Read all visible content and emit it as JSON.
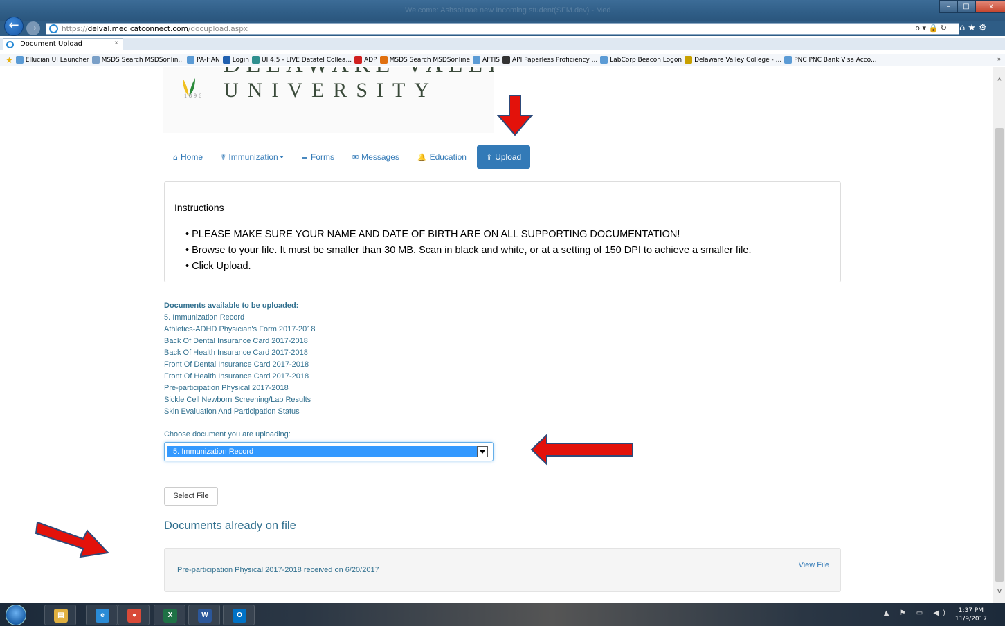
{
  "browser": {
    "window_title": "Welcome: Ashsolinae new Incoming student(SFM.dev) - Med",
    "url_scheme": "https://",
    "url_domain": "delval.medicatconnect.com",
    "url_path": "/docupload.aspx",
    "addr_tools": "ρ ▾ 🔒 ↻",
    "tab_title": "Document Upload",
    "tab_close": "×",
    "favorites": [
      {
        "label": "Ellucian UI Launcher",
        "color": "#5b9bd5"
      },
      {
        "label": "MSDS Search MSDSonlin...",
        "color": "#7aa0c8"
      },
      {
        "label": "PA-HAN",
        "color": "#5b9bd5"
      },
      {
        "label": "Login",
        "color": "#2060b0"
      },
      {
        "label": "UI 4.5 - LIVE Datatel Collea...",
        "color": "#2f8f8f"
      },
      {
        "label": "ADP",
        "color": "#d02020"
      },
      {
        "label": "MSDS Search MSDSonline",
        "color": "#e07010"
      },
      {
        "label": "AFTIS",
        "color": "#5b9bd5"
      },
      {
        "label": "API Paperless Proficiency ...",
        "color": "#333333"
      },
      {
        "label": "LabCorp Beacon Logon",
        "color": "#5b9bd5"
      },
      {
        "label": "Delaware Valley College - ...",
        "color": "#c8a000"
      },
      {
        "label": "PNC PNC Bank Visa Acco...",
        "color": "#5b9bd5"
      }
    ],
    "favorites_more": "»",
    "window_buttons": {
      "minimize": "–",
      "maximize": "□",
      "close": "x"
    }
  },
  "logo": {
    "name_top": "DELAWARE VALLEY",
    "name": "UNIVERSITY",
    "year": "1896"
  },
  "nav": {
    "items": [
      {
        "label": "Home",
        "icon": "home-icon",
        "glyph": "⌂"
      },
      {
        "label": "Immunization",
        "icon": "stethoscope-icon",
        "glyph": "☤"
      },
      {
        "label": "Forms",
        "icon": "list-icon",
        "glyph": "≡"
      },
      {
        "label": "Messages",
        "icon": "envelope-icon",
        "glyph": "✉"
      },
      {
        "label": "Education",
        "icon": "bell-icon",
        "glyph": "🔔"
      },
      {
        "label": "Upload",
        "icon": "upload-icon",
        "glyph": "⇪",
        "active": true
      }
    ]
  },
  "instructions": {
    "title": "Instructions",
    "items": [
      "PLEASE MAKE SURE YOUR NAME AND DATE OF BIRTH ARE ON ALL SUPPORTING DOCUMENTATION!",
      "Browse to your file. It must be smaller than 30 MB. Scan in black and white, or at a setting of 150 DPI to achieve a smaller file.",
      "Click Upload."
    ]
  },
  "documents_available": {
    "heading": "Documents available to be uploaded:",
    "items": [
      "5. Immunization Record",
      "Athletics-ADHD Physician's Form 2017-2018",
      "Back Of Dental Insurance Card 2017-2018",
      "Back Of Health Insurance Card 2017-2018",
      "Front Of Dental Insurance Card 2017-2018",
      "Front Of Health Insurance Card 2017-2018",
      "Pre-participation Physical 2017-2018",
      "Sickle Cell Newborn Screening/Lab Results",
      "Skin Evaluation And Participation Status"
    ]
  },
  "chooser": {
    "label": "Choose document you are uploading:",
    "selected": "5. Immunization Record"
  },
  "select_file_button": "Select File",
  "on_file": {
    "heading": "Documents already on file",
    "record": "Pre-participation Physical 2017-2018 received on 6/20/2017",
    "view_link": "View File"
  },
  "taskbar": {
    "apps": [
      {
        "name": "file-explorer",
        "glyph": "▤",
        "color": "#e0b040"
      },
      {
        "name": "internet-explorer",
        "glyph": "e",
        "color": "#2a8bd6"
      },
      {
        "name": "chrome",
        "glyph": "●",
        "color": "#d84a38"
      },
      {
        "name": "excel",
        "glyph": "X",
        "color": "#1e7145"
      },
      {
        "name": "word",
        "glyph": "W",
        "color": "#2b579a"
      },
      {
        "name": "outlook",
        "glyph": "O",
        "color": "#0072c6"
      }
    ],
    "tray_icons": "▲ ⚑ ▭ ◀)",
    "time": "1:37 PM",
    "date": "11/9/2017"
  },
  "colors": {
    "accent": "#337ab7",
    "link_text": "#31708f",
    "annotation_arrow": "#e3120b",
    "annotation_outline": "#2e4a7a"
  }
}
